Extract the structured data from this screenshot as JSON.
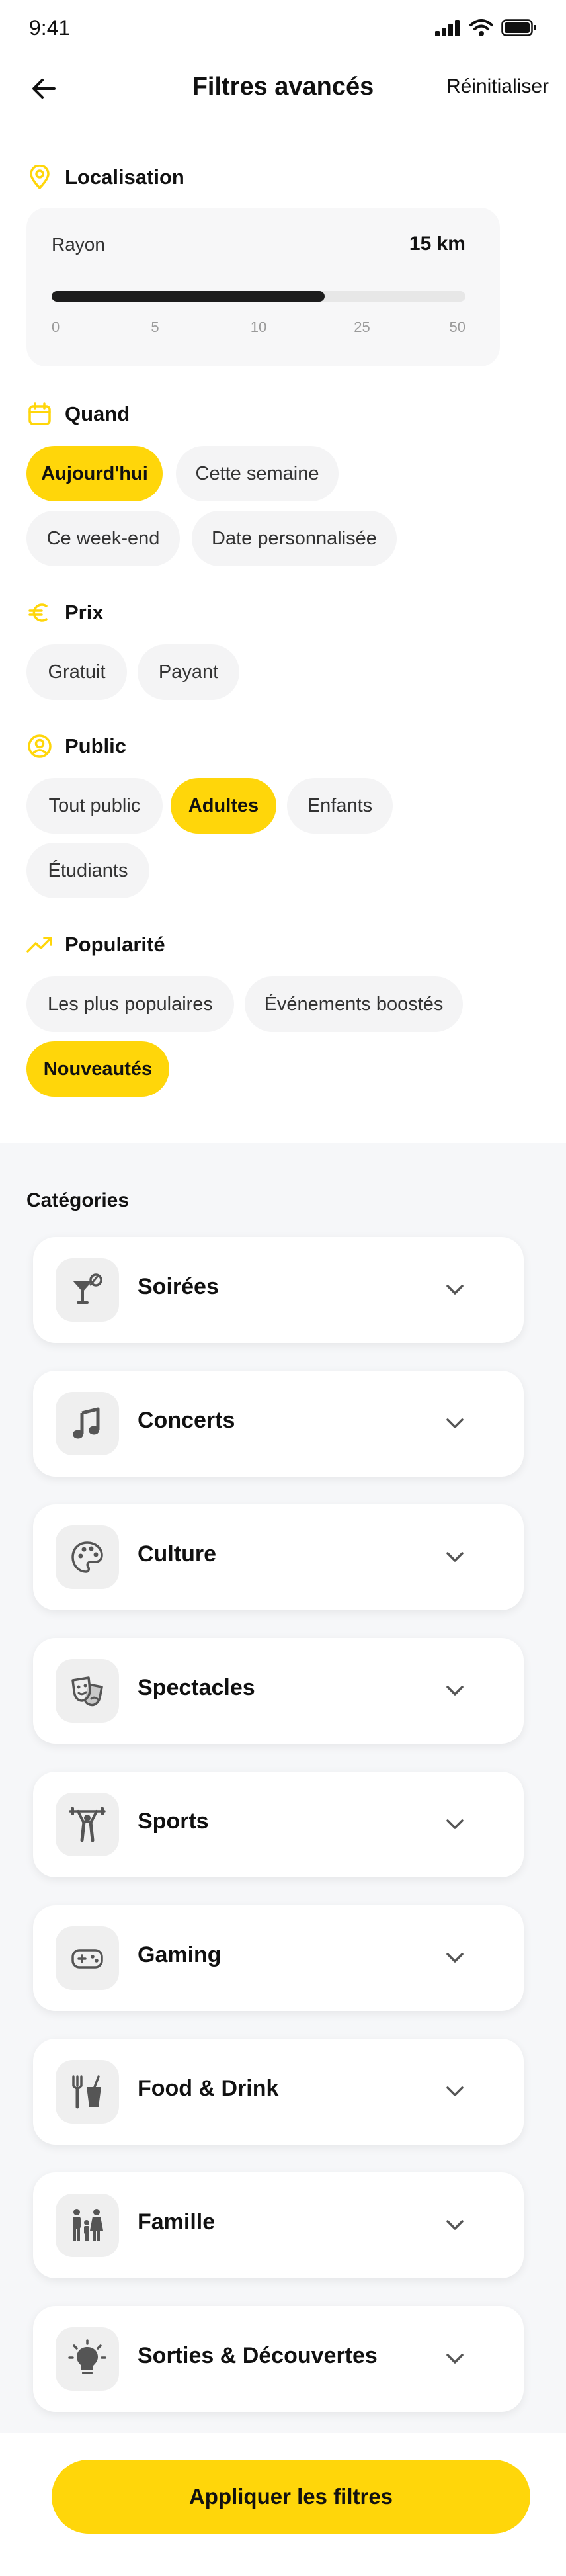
{
  "status_bar": {
    "time": "9:41",
    "icons": [
      "signal-icon",
      "wifi-icon",
      "battery-icon"
    ]
  },
  "header": {
    "title": "Filtres avancés",
    "reset_label": "Réinitialiser",
    "back_icon": "arrow-left-icon"
  },
  "colors": {
    "accent": "#FFD60A",
    "chip_bg": "#F4F4F5",
    "text": "#111111"
  },
  "location": {
    "title": "Localisation",
    "icon": "map-pin-icon",
    "radius_label": "Rayon",
    "radius_value": "15 km",
    "slider_fraction": 0.66,
    "ticks": [
      "0",
      "5",
      "10",
      "25",
      "50"
    ]
  },
  "when": {
    "title": "Quand",
    "icon": "calendar-icon",
    "chips": [
      {
        "label": "Aujourd'hui",
        "active": true
      },
      {
        "label": "Cette semaine",
        "active": false
      },
      {
        "label": "Ce week-end",
        "active": false
      },
      {
        "label": "Date personnalisée",
        "active": false
      }
    ]
  },
  "price": {
    "title": "Prix",
    "icon": "euro-icon",
    "chips": [
      {
        "label": "Gratuit",
        "active": false
      },
      {
        "label": "Payant",
        "active": false
      }
    ]
  },
  "audience": {
    "title": "Public",
    "icon": "user-circle-icon",
    "chips": [
      {
        "label": "Tout public",
        "active": false
      },
      {
        "label": "Adultes",
        "active": true
      },
      {
        "label": "Enfants",
        "active": false
      },
      {
        "label": "Étudiants",
        "active": false
      }
    ]
  },
  "popularity": {
    "title": "Popularité",
    "icon": "trending-up-icon",
    "chips": [
      {
        "label": "Les plus populaires",
        "active": false
      },
      {
        "label": "Événements boostés",
        "active": false
      },
      {
        "label": "Nouveautés",
        "active": true
      }
    ]
  },
  "categories": {
    "title": "Catégories",
    "items": [
      {
        "label": "Soirées",
        "icon": "cocktail-icon"
      },
      {
        "label": "Concerts",
        "icon": "music-note-icon"
      },
      {
        "label": "Culture",
        "icon": "palette-icon"
      },
      {
        "label": "Spectacles",
        "icon": "theater-masks-icon"
      },
      {
        "label": "Sports",
        "icon": "weightlifting-icon"
      },
      {
        "label": "Gaming",
        "icon": "gamepad-icon"
      },
      {
        "label": "Food & Drink",
        "icon": "fork-knife-cup-icon"
      },
      {
        "label": "Famille",
        "icon": "family-icon"
      },
      {
        "label": "Sorties & Découvertes",
        "icon": "lightbulb-icon"
      }
    ]
  },
  "apply_label": "Appliquer les filtres"
}
